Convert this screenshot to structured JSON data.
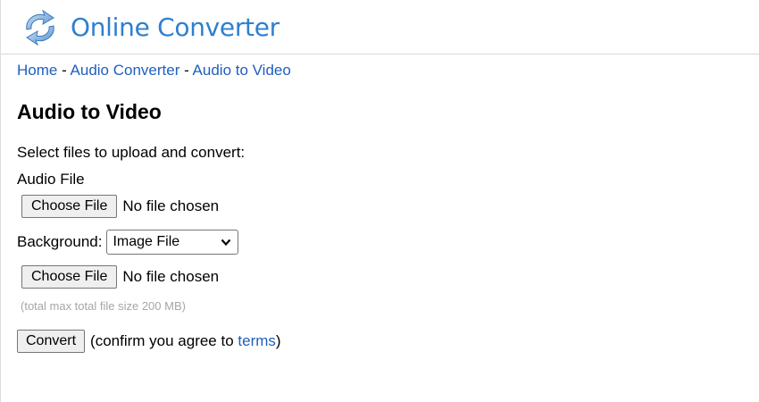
{
  "header": {
    "logo_icon": "refresh-arrows-icon",
    "site_title": "Online Converter"
  },
  "breadcrumb": {
    "items": [
      "Home",
      "Audio Converter",
      "Audio to Video"
    ],
    "separator": " - "
  },
  "page": {
    "title": "Audio to Video",
    "instructions": "Select files to upload and convert:",
    "audio_file_label": "Audio File",
    "background_label": "Background:",
    "background_selected": "Image File",
    "size_note": "(total max total file size 200 MB)"
  },
  "file_inputs": {
    "audio": {
      "button_label": "Choose File",
      "status": "No file chosen"
    },
    "background": {
      "button_label": "Choose File",
      "status": "No file chosen"
    }
  },
  "convert": {
    "button_label": "Convert",
    "confirm_prefix": "(confirm you agree to ",
    "terms_link": "terms",
    "confirm_suffix": ")"
  },
  "colors": {
    "brand": "#2f7fcf",
    "link": "#1f5fbf",
    "note": "#a6a6a6"
  }
}
